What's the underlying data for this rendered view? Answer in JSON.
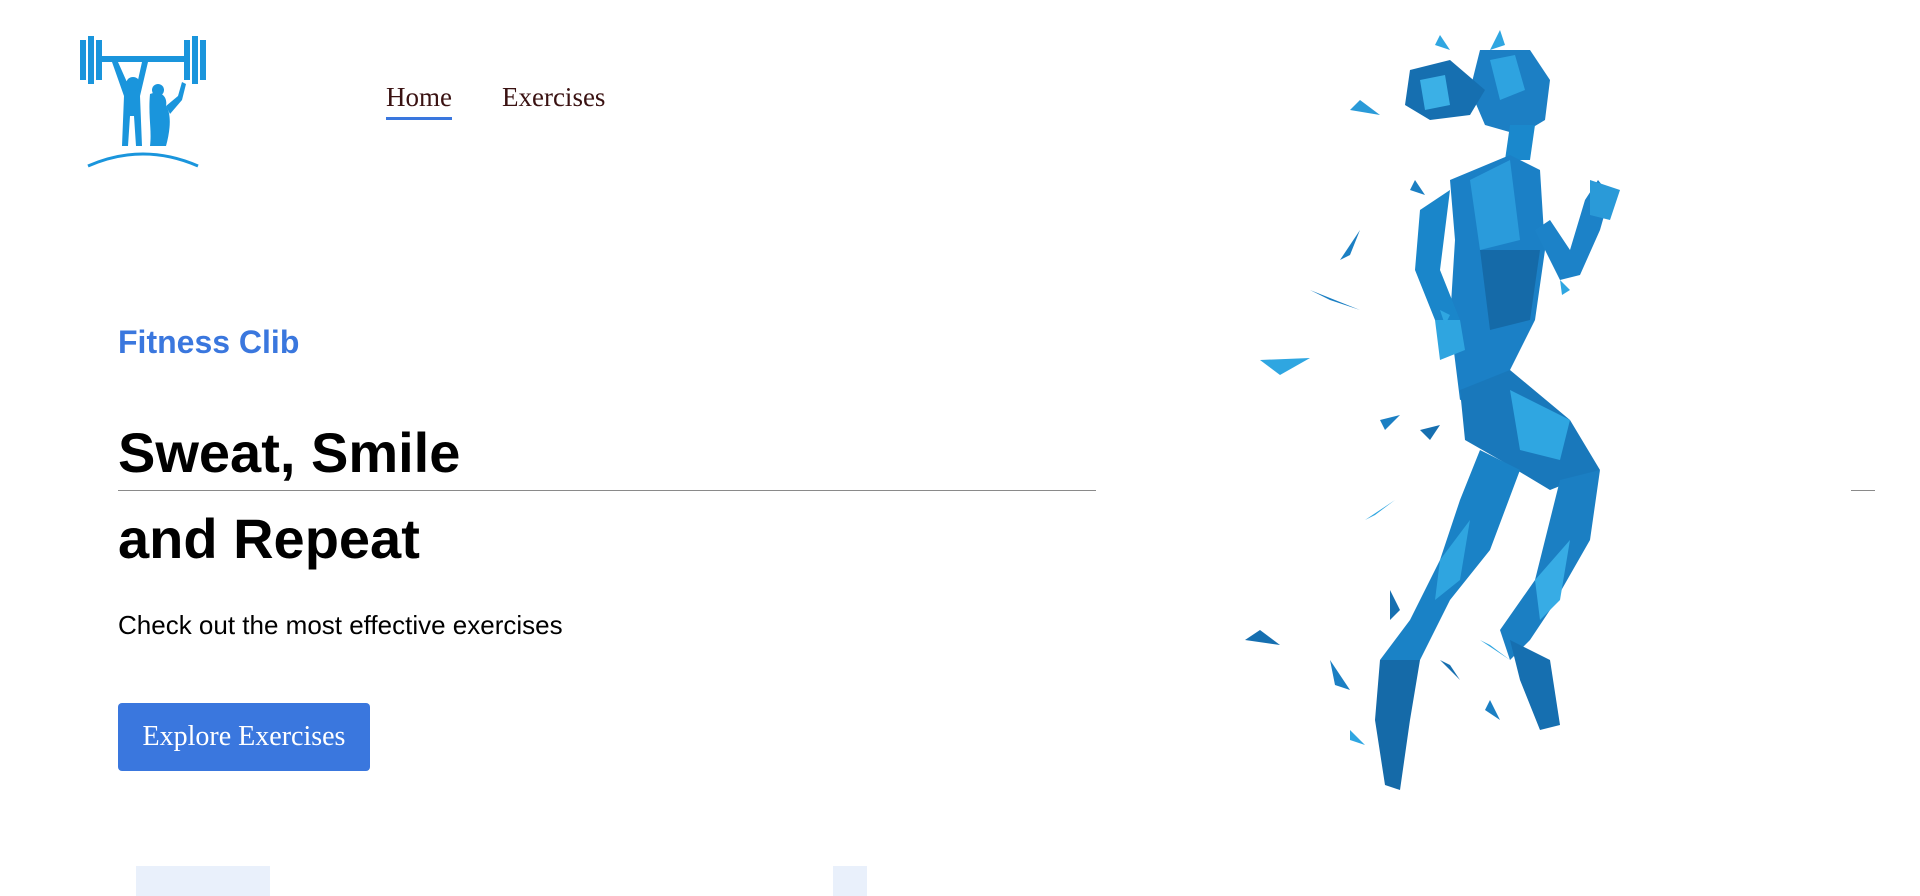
{
  "header": {
    "logo_icon": "weightlifting-logo-icon",
    "nav": [
      {
        "label": "Home",
        "active": true
      },
      {
        "label": "Exercises",
        "active": false
      }
    ]
  },
  "hero": {
    "club_name": "Fitness Clib",
    "headline_line1": "Sweat, Smile",
    "headline_line2": "and Repeat",
    "subtext": "Check out the most effective exercises",
    "cta_label": "Explore Exercises",
    "image_icon": "runner-illustration"
  },
  "colors": {
    "accent": "#3a77de",
    "nav_text": "#3a1212",
    "figure_blue": "#1a8fd0"
  }
}
